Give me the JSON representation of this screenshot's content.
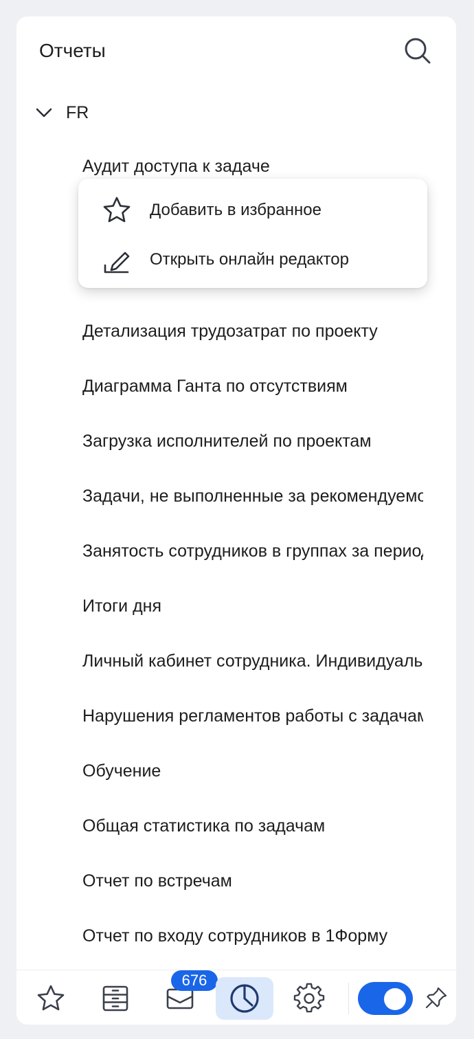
{
  "header": {
    "title": "Отчеты",
    "search_icon": "search-icon"
  },
  "group": {
    "label": "FR",
    "icon": "chevron-down-icon",
    "expanded": true
  },
  "reports": [
    "Аудит доступа к задаче",
    "Детализация трудозатрат по проекту",
    "Диаграмма Ганта по отсутствиям",
    "Загрузка исполнителей по проектам",
    "Задачи, не выполненные за рекомендуемое время",
    "Занятость сотрудников в группах за период",
    "Итоги дня",
    "Личный кабинет сотрудника. Индивидуальные показатели",
    "Нарушения регламентов работы с задачами",
    "Обучение",
    "Общая статистика по задачам",
    "Отчет по встречам",
    "Отчет по входу сотрудников в 1Форму"
  ],
  "context_menu": {
    "items": [
      {
        "label": "Добавить в избранное",
        "icon": "star-outline-icon"
      },
      {
        "label": "Открыть онлайн редактор",
        "icon": "pencil-edit-icon"
      }
    ]
  },
  "footer": {
    "favorites_icon": "star-outline-icon",
    "archive_icon": "archive-drawer-icon",
    "mail_icon": "envelope-icon",
    "mail_badge": "676",
    "reports_icon": "pie-chart-clock-icon",
    "settings_icon": "gear-icon",
    "toggle_on": true,
    "pin_icon": "pin-icon"
  },
  "colors": {
    "accent": "#1a66e8",
    "active_bg": "#dbe8fb",
    "icon": "#3a3f4a",
    "active_icon": "#1f3a6e"
  }
}
